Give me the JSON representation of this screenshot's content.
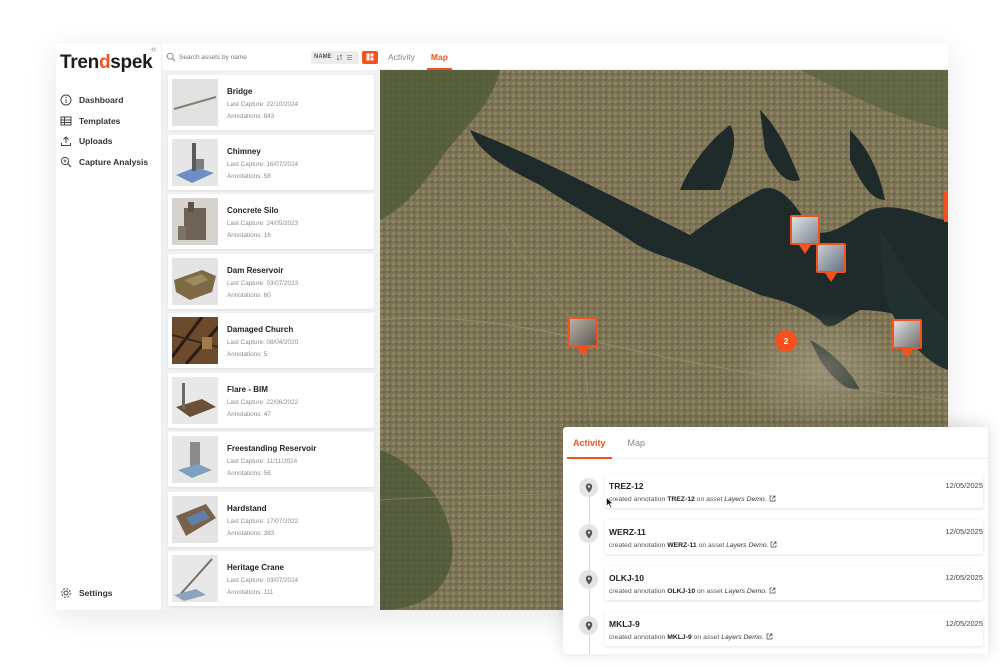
{
  "sidebar": {
    "logo_left": "Tren",
    "logo_accent": "d",
    "logo_right": "spek",
    "collapse_glyph": "«",
    "items": [
      {
        "label": "Dashboard",
        "icon": "info-circle-icon"
      },
      {
        "label": "Templates",
        "icon": "table-icon"
      },
      {
        "label": "Uploads",
        "icon": "upload-icon"
      },
      {
        "label": "Capture Analysis",
        "icon": "magnifier-icon"
      }
    ],
    "settings_label": "Settings"
  },
  "search": {
    "placeholder": "Search assets by name",
    "sort_label": "NAME"
  },
  "assets": [
    {
      "name": "Bridge",
      "last_capture": "Last Capture: 22/10/2024",
      "annotations": "Annotations: 843"
    },
    {
      "name": "Chimney",
      "last_capture": "Last Capture: 16/07/2024",
      "annotations": "Annotations: 58"
    },
    {
      "name": "Concrete Silo",
      "last_capture": "Last Capture: 24/05/2023",
      "annotations": "Annotations: 16"
    },
    {
      "name": "Dam Reservoir",
      "last_capture": "Last Capture: 03/07/2023",
      "annotations": "Annotations: 60"
    },
    {
      "name": "Damaged Church",
      "last_capture": "Last Capture: 08/04/2020",
      "annotations": "Annotations: 5"
    },
    {
      "name": "Flare - BIM",
      "last_capture": "Last Capture: 22/06/2022",
      "annotations": "Annotations: 47"
    },
    {
      "name": "Freestanding Reservoir",
      "last_capture": "Last Capture: 11/11/2024",
      "annotations": "Annotations: 56"
    },
    {
      "name": "Hardstand",
      "last_capture": "Last Capture: 17/07/2022",
      "annotations": "Annotations: 383"
    },
    {
      "name": "Heritage Crane",
      "last_capture": "Last Capture: 03/07/2024",
      "annotations": "Annotations: 111"
    }
  ],
  "tabs": {
    "activity": "Activity",
    "map": "Map"
  },
  "map": {
    "cluster_count": "2"
  },
  "activity_panel": {
    "tab_activity": "Activity",
    "tab_map": "Map",
    "items": [
      {
        "title": "TREZ-12",
        "date": "12/05/2025",
        "prefix": "created annotation",
        "code": "TREZ-12",
        "mid": "on asset",
        "asset": "Layers Demo."
      },
      {
        "title": "WERZ-11",
        "date": "12/05/2025",
        "prefix": "created annotation",
        "code": "WERZ-11",
        "mid": "on asset",
        "asset": "Layers Demo."
      },
      {
        "title": "OLKJ-10",
        "date": "12/05/2025",
        "prefix": "created annotation",
        "code": "OLKJ-10",
        "mid": "on asset",
        "asset": "Layers Demo."
      },
      {
        "title": "MKLJ-9",
        "date": "12/05/2025",
        "prefix": "created annotation",
        "code": "MKLJ-9",
        "mid": "on asset",
        "asset": "Layers Demo."
      }
    ]
  },
  "colors": {
    "accent": "#f4511e",
    "map_land": "#7a7052",
    "map_water": "#1f2a2a"
  }
}
